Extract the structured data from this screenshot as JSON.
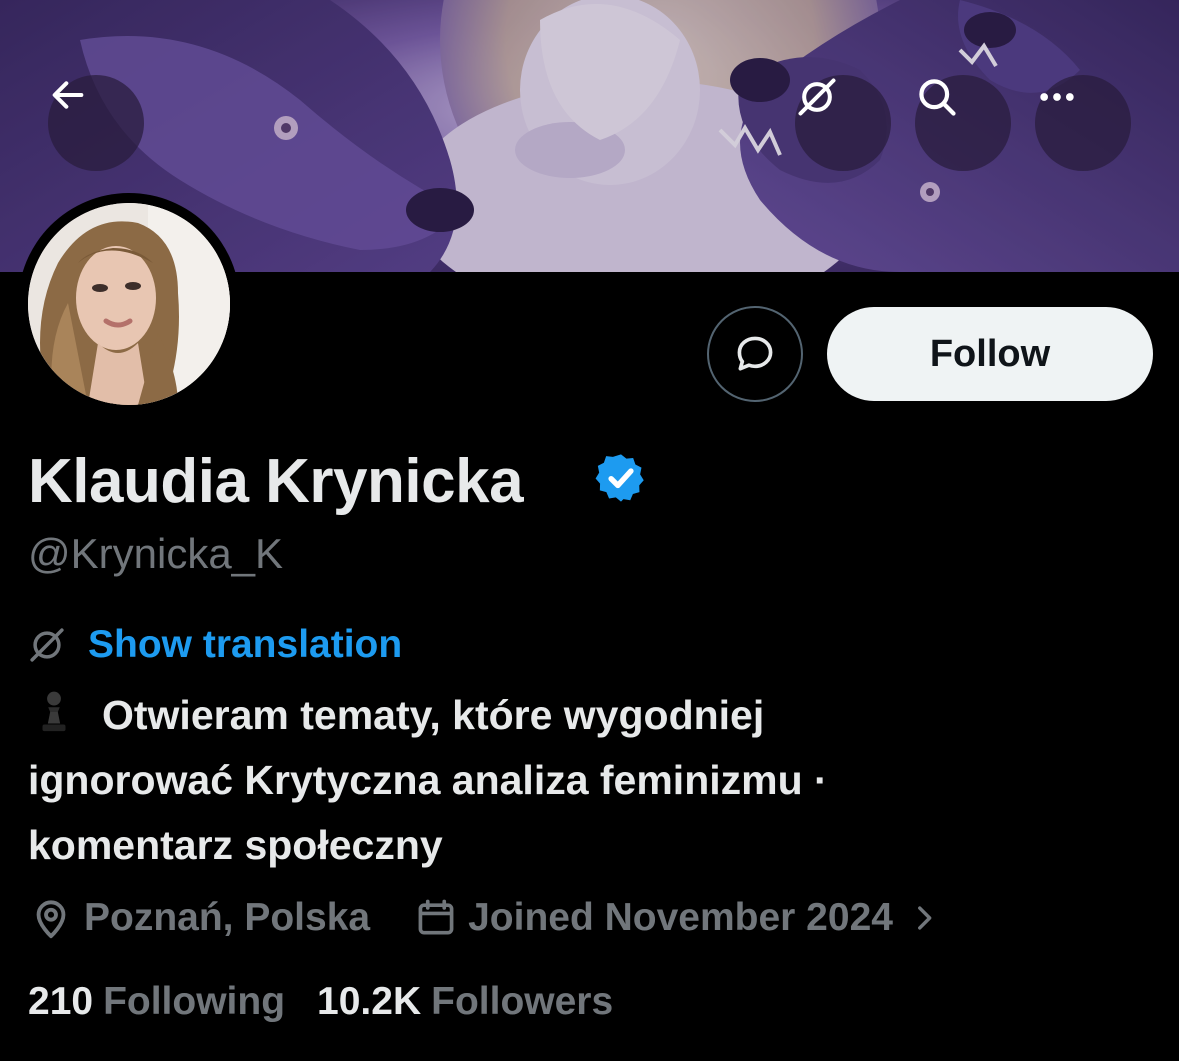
{
  "header": {
    "back_icon": "arrow-left-icon",
    "translate_icon": "grok-icon",
    "search_icon": "search-icon",
    "more_icon": "more-horizontal-icon"
  },
  "profile": {
    "display_name": "Klaudia Krynicka",
    "verified": true,
    "verified_color": "#1d9bf0",
    "handle": "@Krynicka_K",
    "follow_label": "Follow",
    "translate_label": "Show translation",
    "bio_emoji": "♟",
    "bio_lines": [
      "Otwieram tematy, które wygodniej",
      "ignorować Krytyczna analiza feminizmu ·",
      "komentarz społeczny"
    ],
    "location": "Poznań, Polska",
    "joined": "Joined November 2024",
    "following_count": "210",
    "following_label": "Following",
    "followers_count": "10.2K",
    "followers_label": "Followers"
  },
  "colors": {
    "background": "#000000",
    "accent": "#1d9bf0",
    "secondary_text": "#71767b",
    "primary_text": "#e7e9ea",
    "follow_bg": "#eff3f4"
  }
}
